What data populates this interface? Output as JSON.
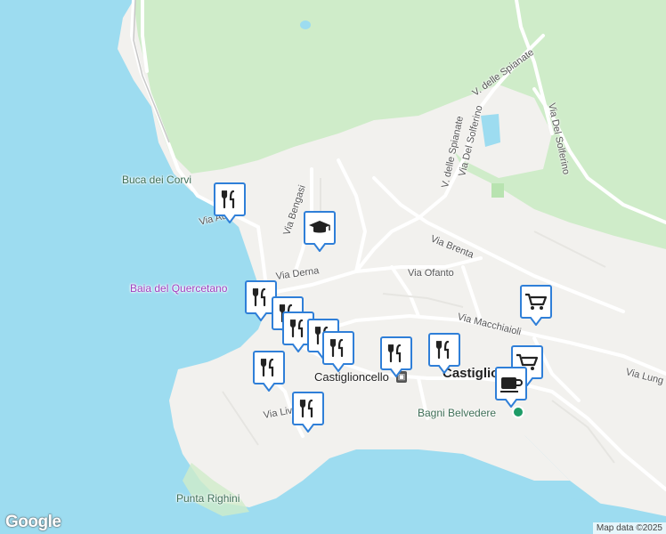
{
  "colors": {
    "water": "#9ddcf0",
    "land": "#f2f1ee",
    "park": "#cfecc9",
    "road": "#ffffff",
    "marker_blue": "#2f7fd8",
    "poi_green": "#1e9c67"
  },
  "labels": {
    "buca": "Buca dei Corvi",
    "baia": "Baia del Quercetano",
    "castiglioncello_small": "Castiglioncello",
    "castiglioncello_big": "Castiglio",
    "bagni": "Bagni Belvedere",
    "punta": "Punta Righini"
  },
  "roads": {
    "aurelia": "Via Aurelia",
    "bengasi": "Via Bengasi",
    "derna": "Via Derna",
    "ofanto": "Via Ofanto",
    "brenta": "Via Brenta",
    "macchiaioli": "Via Macchiaioli",
    "lung": "Via Lung",
    "livi": "Via Livi",
    "spianate1": "V. delle Spianate",
    "spianate2": "V. delle Spianate",
    "solferino1": "Via Del Solferino",
    "solferino2": "Via Del Solferino"
  },
  "markers": [
    {
      "type": "restaurant-icon",
      "name": "marker-restaurant"
    },
    {
      "type": "school-icon",
      "name": "marker-school"
    },
    {
      "type": "restaurant-icon",
      "name": "marker-restaurant"
    },
    {
      "type": "restaurant-icon",
      "name": "marker-restaurant"
    },
    {
      "type": "restaurant-icon",
      "name": "marker-restaurant"
    },
    {
      "type": "restaurant-icon",
      "name": "marker-restaurant"
    },
    {
      "type": "restaurant-icon",
      "name": "marker-restaurant"
    },
    {
      "type": "restaurant-icon",
      "name": "marker-restaurant"
    },
    {
      "type": "restaurant-icon",
      "name": "marker-restaurant"
    },
    {
      "type": "restaurant-icon",
      "name": "marker-restaurant"
    },
    {
      "type": "shopping-cart-icon",
      "name": "marker-shop"
    },
    {
      "type": "shopping-cart-icon",
      "name": "marker-shop"
    },
    {
      "type": "coffee-icon",
      "name": "marker-cafe"
    }
  ],
  "footer": {
    "google": "Google",
    "attribution": "Map data ©2025"
  }
}
